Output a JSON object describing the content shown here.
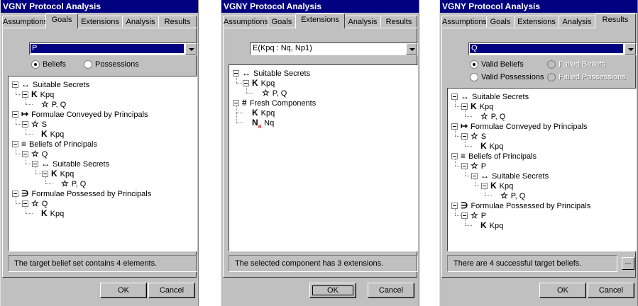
{
  "app_title": "VGNY Protocol Analysis",
  "tabs": [
    "Assumptions",
    "Goals",
    "Extensions",
    "Analysis",
    "Results"
  ],
  "ok_label": "OK",
  "cancel_label": "Cancel",
  "windows": [
    {
      "active_tab": "Goals",
      "combo_value": "P",
      "radios": [
        {
          "label": "Beliefs",
          "checked": true,
          "enabled": true
        },
        {
          "label": "Possessions",
          "checked": false,
          "enabled": true
        }
      ],
      "tree": [
        {
          "text": "Suitable Secrets",
          "icon": "double-arrow-icon",
          "depth": 0
        },
        {
          "text": "Kpq",
          "icon": "key-k-icon",
          "depth": 1
        },
        {
          "text": "P, Q",
          "icon": "principal-icon",
          "depth": 2
        },
        {
          "text": "Formulae Conveyed by Principals",
          "icon": "conveyed-icon",
          "depth": 0
        },
        {
          "text": "S",
          "icon": "principal-icon",
          "depth": 1
        },
        {
          "text": "Kpq",
          "icon": "key-k-icon",
          "depth": 2
        },
        {
          "text": "Beliefs of Principals",
          "icon": "beliefs-icon",
          "depth": 0
        },
        {
          "text": "Q",
          "icon": "principal-icon",
          "depth": 1
        },
        {
          "text": "Suitable Secrets",
          "icon": "double-arrow-icon",
          "depth": 2
        },
        {
          "text": "Kpq",
          "icon": "key-k-icon",
          "depth": 3
        },
        {
          "text": "P, Q",
          "icon": "principal-icon",
          "depth": 4
        },
        {
          "text": "Formulae Possessed by Principals",
          "icon": "possessed-icon",
          "depth": 0
        },
        {
          "text": "Q",
          "icon": "principal-icon",
          "depth": 1
        },
        {
          "text": "Kpq",
          "icon": "key-k-icon",
          "depth": 2
        }
      ],
      "status": "The target belief set contains 4 elements."
    },
    {
      "active_tab": "Extensions",
      "combo_value": "E(Kpq : Nq, Np1)",
      "radios": [],
      "tree": [
        {
          "text": "Suitable Secrets",
          "icon": "double-arrow-icon",
          "depth": 0
        },
        {
          "text": "Kpq",
          "icon": "key-k-icon",
          "depth": 1
        },
        {
          "text": "P, Q",
          "icon": "principal-icon",
          "depth": 2
        },
        {
          "text": "Fresh Components",
          "icon": "fresh-icon",
          "depth": 0
        },
        {
          "text": "Kpq",
          "icon": "key-k-icon",
          "depth": 1
        },
        {
          "text": "Nq",
          "icon": "nonce-icon",
          "depth": 1
        }
      ],
      "status": "The selected component has 3 extensions."
    },
    {
      "active_tab": "Results",
      "combo_value": "Q",
      "radios": [
        {
          "label": "Valid Beliefs",
          "checked": true,
          "enabled": true
        },
        {
          "label": "Failed Beliefs",
          "checked": false,
          "enabled": false
        },
        {
          "label": "Valid Possessions",
          "checked": false,
          "enabled": true
        },
        {
          "label": "Failed Possessions",
          "checked": false,
          "enabled": false
        }
      ],
      "tree": [
        {
          "text": "Suitable Secrets",
          "icon": "double-arrow-icon",
          "depth": 0
        },
        {
          "text": "Kpq",
          "icon": "key-k-icon",
          "depth": 1
        },
        {
          "text": "P, Q",
          "icon": "principal-icon",
          "depth": 2
        },
        {
          "text": "Formulae Conveyed by Principals",
          "icon": "conveyed-icon",
          "depth": 0
        },
        {
          "text": "S",
          "icon": "principal-icon",
          "depth": 1
        },
        {
          "text": "Kpq",
          "icon": "key-k-icon",
          "depth": 2
        },
        {
          "text": "Beliefs of Principals",
          "icon": "beliefs-icon",
          "depth": 0
        },
        {
          "text": "P",
          "icon": "principal-icon",
          "depth": 1
        },
        {
          "text": "Suitable Secrets",
          "icon": "double-arrow-icon",
          "depth": 2
        },
        {
          "text": "Kpq",
          "icon": "key-k-icon",
          "depth": 3
        },
        {
          "text": "P, Q",
          "icon": "principal-icon",
          "depth": 4
        },
        {
          "text": "Formulae Possessed by Principals",
          "icon": "possessed-icon",
          "depth": 0
        },
        {
          "text": "P",
          "icon": "principal-icon",
          "depth": 1
        },
        {
          "text": "Kpq",
          "icon": "key-k-icon",
          "depth": 2
        }
      ],
      "status": "There are 4 successful target beliefs.",
      "ellipsis_label": "..."
    }
  ],
  "colors": {
    "title_bar": "#000080",
    "face": "#c0c0c0",
    "nonce_subscript": "#d00000"
  }
}
